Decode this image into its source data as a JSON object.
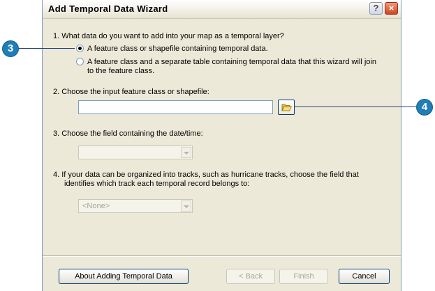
{
  "window": {
    "title": "Add Temporal Data Wizard",
    "help_glyph": "?",
    "close_glyph": "×"
  },
  "step1": {
    "question": "1.  What data do you want to add into your map as a temporal layer?",
    "option_feature_class": "A feature class or shapefile containing temporal data.",
    "option_separate_table_line1": "A feature class and a separate table containing temporal data that this wizard will join",
    "option_separate_table_line2": "to the feature class.",
    "selected": "feature_class"
  },
  "step2": {
    "question": "2.  Choose the input feature class or shapefile:",
    "input_value": ""
  },
  "step3": {
    "question": "3.  Choose the field containing the date/time:",
    "select_value": ""
  },
  "step4": {
    "question_line1": "4.  If your data can be organized into tracks, such as hurricane tracks, choose the field that",
    "question_line2": "identifies which track each temporal record belongs to:",
    "select_value": "<None>"
  },
  "buttons": {
    "about": "About Adding Temporal Data",
    "back": "< Back",
    "finish": "Finish",
    "cancel": "Cancel"
  },
  "callouts": {
    "step3": "3",
    "step4": "4"
  },
  "colors": {
    "callout_fill": "#1f7eb8",
    "dialog_face": "#ece9d8"
  },
  "icons": {
    "browse": "folder-open-icon",
    "help": "help-icon",
    "close": "close-icon"
  }
}
